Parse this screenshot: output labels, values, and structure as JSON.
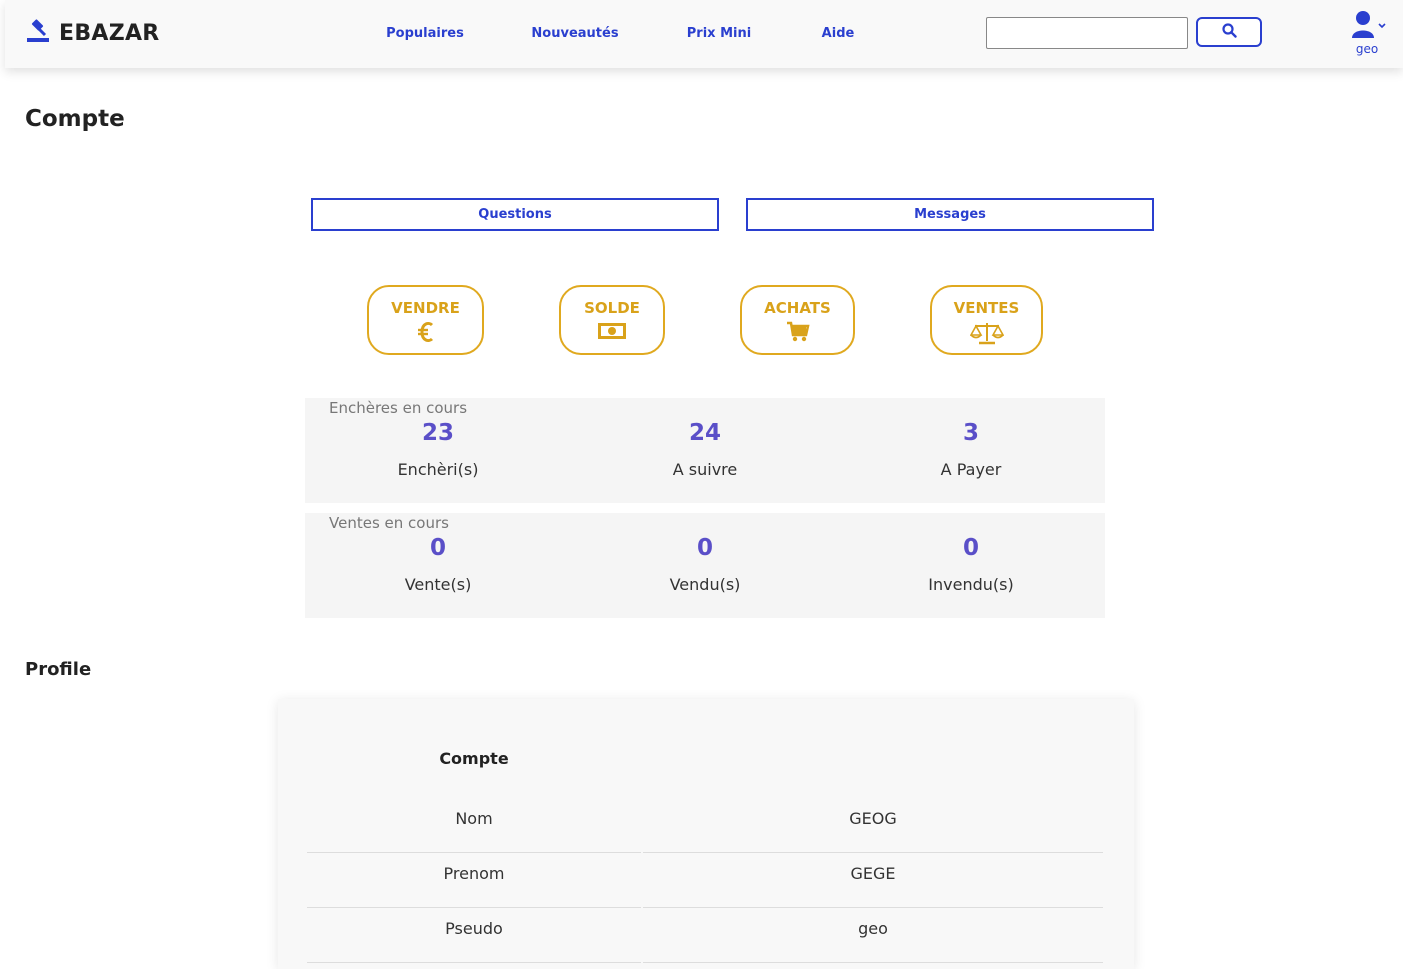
{
  "header": {
    "brand": "EBAZAR",
    "nav": [
      "Populaires",
      "Nouveautés",
      "Prix Mini",
      "Aide"
    ],
    "search_placeholder": "",
    "username": "geo"
  },
  "page": {
    "title": "Compte"
  },
  "tabs": {
    "questions": "Questions",
    "messages": "Messages"
  },
  "actions": {
    "vendre": "VENDRE",
    "solde": "SOLDE",
    "achats": "ACHATS",
    "ventes": "VENTES"
  },
  "encheres": {
    "caption": "Enchères en cours",
    "items": [
      {
        "value": "23",
        "label": "Enchèri(s)"
      },
      {
        "value": "24",
        "label": "A suivre"
      },
      {
        "value": "3",
        "label": "A Payer"
      }
    ]
  },
  "ventes": {
    "caption": "Ventes en cours",
    "items": [
      {
        "value": "0",
        "label": "Vente(s)"
      },
      {
        "value": "0",
        "label": "Vendu(s)"
      },
      {
        "value": "0",
        "label": "Invendu(s)"
      }
    ]
  },
  "profile": {
    "title": "Profile",
    "header": "Compte",
    "rows": [
      {
        "label": "Nom",
        "value": "GEOG"
      },
      {
        "label": "Prenom",
        "value": "GEGE"
      },
      {
        "label": "Pseudo",
        "value": "geo"
      }
    ]
  },
  "colors": {
    "accent": "#2a3fcf",
    "gold": "#e0a91f",
    "stat": "#5a4fc8"
  }
}
